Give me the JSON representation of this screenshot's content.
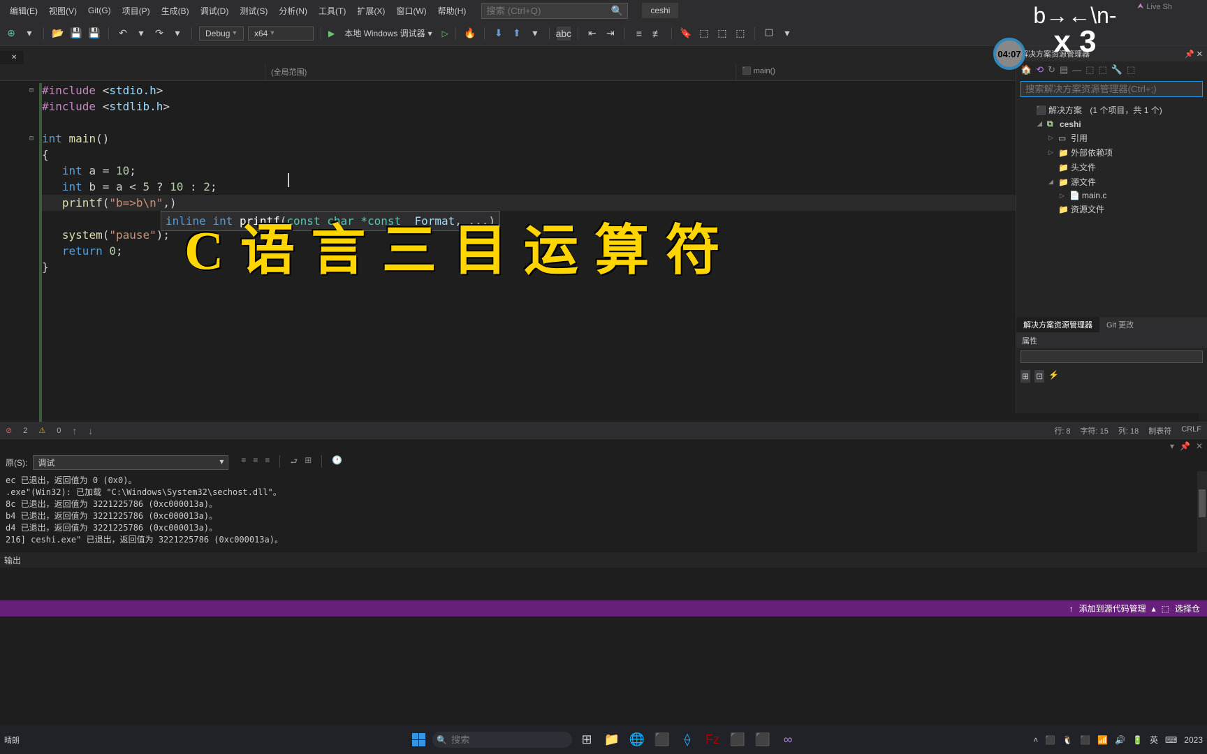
{
  "menu": [
    "编辑(E)",
    "视图(V)",
    "Git(G)",
    "项目(P)",
    "生成(B)",
    "调试(D)",
    "测试(S)",
    "分析(N)",
    "工具(T)",
    "扩展(X)",
    "窗口(W)",
    "帮助(H)"
  ],
  "search": {
    "placeholder": "搜索 (Ctrl+Q)"
  },
  "user": "ceshi",
  "toolbar": {
    "config": "Debug",
    "platform": "x64",
    "runner": "本地 Windows 调试器"
  },
  "nav": {
    "scope": "(全局范围)",
    "func": "main()"
  },
  "code": {
    "l1": "#include <stdio.h>",
    "l2": "#include <stdlib.h>",
    "l3": "",
    "l4_kw": "int",
    "l4_rest": " main()",
    "l5": "{",
    "l6": "   int a = 10;",
    "l7": "   int b = a < 5 ? 10 : 2;",
    "l8": "   printf(\"b=>b\\n\",)",
    "l9": "",
    "l10": "   system(\"pause\");",
    "l11": "   return 0;",
    "l12": "}"
  },
  "tooltip": {
    "sig": "inline int printf(const char *const _Format, ...)"
  },
  "big_title": "C 语 言 三 目 运 算 符",
  "status": {
    "errors": "2",
    "warnings": "0",
    "line": "行: 8",
    "char": "字符: 15",
    "col": "列: 18",
    "tab": "制表符",
    "eol": "CRLF"
  },
  "output": {
    "label": "原(S):",
    "source": "调试",
    "lines": [
      "ec 已退出，返回值为 0 (0x0)。",
      ".exe\"(Win32): 已加载 \"C:\\Windows\\System32\\sechost.dll\"。",
      "8c 已退出，返回值为 3221225786 (0xc000013a)。",
      "b4 已退出，返回值为 3221225786 (0xc000013a)。",
      "d4 已退出，返回值为 3221225786 (0xc000013a)。",
      "216] ceshi.exe\" 已退出，返回值为 3221225786 (0xc000013a)。"
    ],
    "tab": "输出"
  },
  "solution": {
    "panel_title": "解决方案资源管理器",
    "search_placeholder": "搜索解决方案资源管理器(Ctrl+;)",
    "root": "解决方案",
    "root_suffix": "(1 个项目，共 1 个)",
    "project": "ceshi",
    "items": [
      "引用",
      "外部依赖项",
      "头文件",
      "源文件",
      "main.c",
      "资源文件"
    ],
    "tabs": [
      "解决方案资源管理器",
      "Git 更改"
    ],
    "props": "属性"
  },
  "annot": {
    "timer": "04:07",
    "big": "x 3",
    "top": "b→←\\n-"
  },
  "bottomstatus": {
    "add": "添加到源代码管理",
    "select": "选择仓"
  },
  "taskbar_search": "搜索",
  "weather": "晴朗",
  "date": "2023",
  "live": "Live Sh"
}
